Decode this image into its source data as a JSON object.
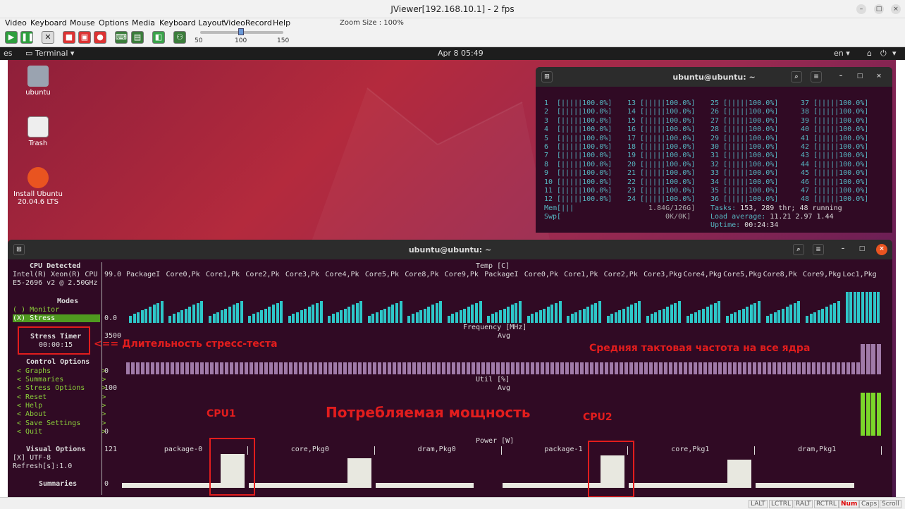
{
  "window": {
    "title": "JViewer[192.168.10.1] - 2 fps"
  },
  "menu": {
    "items": [
      "Video",
      "Keyboard",
      "Mouse",
      "Options",
      "Media",
      "Keyboard Layout",
      "VideoRecord",
      "Help"
    ],
    "zoom_label": "Zoom Size : 100%"
  },
  "slider": {
    "ticks": [
      "50",
      "100",
      "150"
    ],
    "value": 100
  },
  "ubuntu_bar": {
    "app": "Terminal",
    "date": "Apr 8  05:49",
    "lang": "en"
  },
  "desktop": {
    "icons": [
      {
        "label": "ubuntu"
      },
      {
        "label": "Trash"
      },
      {
        "label": "Install Ubuntu 20.04.6 LTS"
      }
    ]
  },
  "htop": {
    "title": "ubuntu@ubuntu: ~",
    "cols": [
      {
        "nums": [
          "1",
          "2",
          "3",
          "4",
          "5",
          "6",
          "7",
          "8",
          "9",
          "10",
          "11",
          "12"
        ]
      },
      {
        "nums": [
          "13",
          "14",
          "15",
          "16",
          "17",
          "18",
          "19",
          "20",
          "21",
          "22",
          "23",
          "24"
        ]
      },
      {
        "nums": [
          "25",
          "26",
          "27",
          "28",
          "29",
          "30",
          "31",
          "32",
          "33",
          "34",
          "35",
          "36"
        ]
      },
      {
        "nums": [
          "37",
          "38",
          "39",
          "40",
          "41",
          "42",
          "43",
          "44",
          "45",
          "46",
          "47",
          "48"
        ]
      }
    ],
    "bar": "[|||||100.0%]",
    "mem_label": "Mem[|||",
    "mem_value": "1.84G/126G]",
    "swp_label": "Swp[",
    "swp_value": "0K/0K]",
    "tasks_prefix": "Tasks: ",
    "tasks_value": "153, 289 thr; 48 running",
    "load_prefix": "Load average: ",
    "load_value": "11.21 2.97 1.44",
    "uptime_prefix": "Uptime: ",
    "uptime_value": "00:24:34"
  },
  "stui": {
    "title": "ubuntu@ubuntu: ~",
    "cpu_detected": "CPU Detected",
    "cpu_name": "Intel(R) Xeon(R) CPU",
    "cpu_model": "E5-2696 v2 @ 2.50GHz",
    "modes": "Modes",
    "monitor": "( ) Monitor",
    "stress": "(X) Stress",
    "stress_timer": "Stress Timer",
    "timer_value": "00:00:15",
    "control_options": "Control Options",
    "controls": [
      "< Graphs            >",
      "< Summaries         >",
      "< Stress Options    >",
      "< Reset             >",
      "< Help              >",
      "< About             >",
      "< Save Settings     >",
      "< Quit              >"
    ],
    "visual_options": "Visual Options",
    "utf8": "[X] UTF-8",
    "refresh": "Refresh[s]:1.0",
    "summaries": "Summaries",
    "temp": {
      "title": "Temp [C]",
      "top": "99.0",
      "bottom": "0.0",
      "headers": [
        "PackageI",
        "Core0,Pk",
        "Core1,Pk",
        "Core2,Pk",
        "Core3,Pk",
        "Core4,Pk",
        "Core5,Pk",
        "Core8,Pk",
        "Core9,Pk",
        "PackageI",
        "Core0,Pk",
        "Core1,Pk",
        "Core2,Pk",
        "Core3,Pkg",
        "Core4,Pkg",
        "Core5,Pkg",
        "Core8,Pk",
        "Core9,Pkg",
        "Loc1,Pkg"
      ]
    },
    "freq": {
      "title": "Frequency [MHz]",
      "sub": "Avg",
      "top": "3500",
      "bottom": "0"
    },
    "util": {
      "title": "Util [%]",
      "sub": "Avg",
      "top": "100",
      "bottom": "0"
    },
    "power": {
      "title": "Power [W]",
      "top": "121",
      "bottom": "0",
      "headers": [
        "package-0",
        "core,Pkg0",
        "dram,Pkg0",
        "package-1",
        "core,Pkg1",
        "dram,Pkg1"
      ]
    }
  },
  "annotations": {
    "timer": "<== Длительность стресс-теста",
    "freq": "Средняя тактовая частота на все ядра",
    "power": "Потребляемая мощность",
    "cpu1": "CPU1",
    "cpu2": "CPU2"
  },
  "statusbar": [
    "LALT",
    "LCTRL",
    "RALT",
    "RCTRL",
    "Num",
    "Caps",
    "Scroll"
  ]
}
